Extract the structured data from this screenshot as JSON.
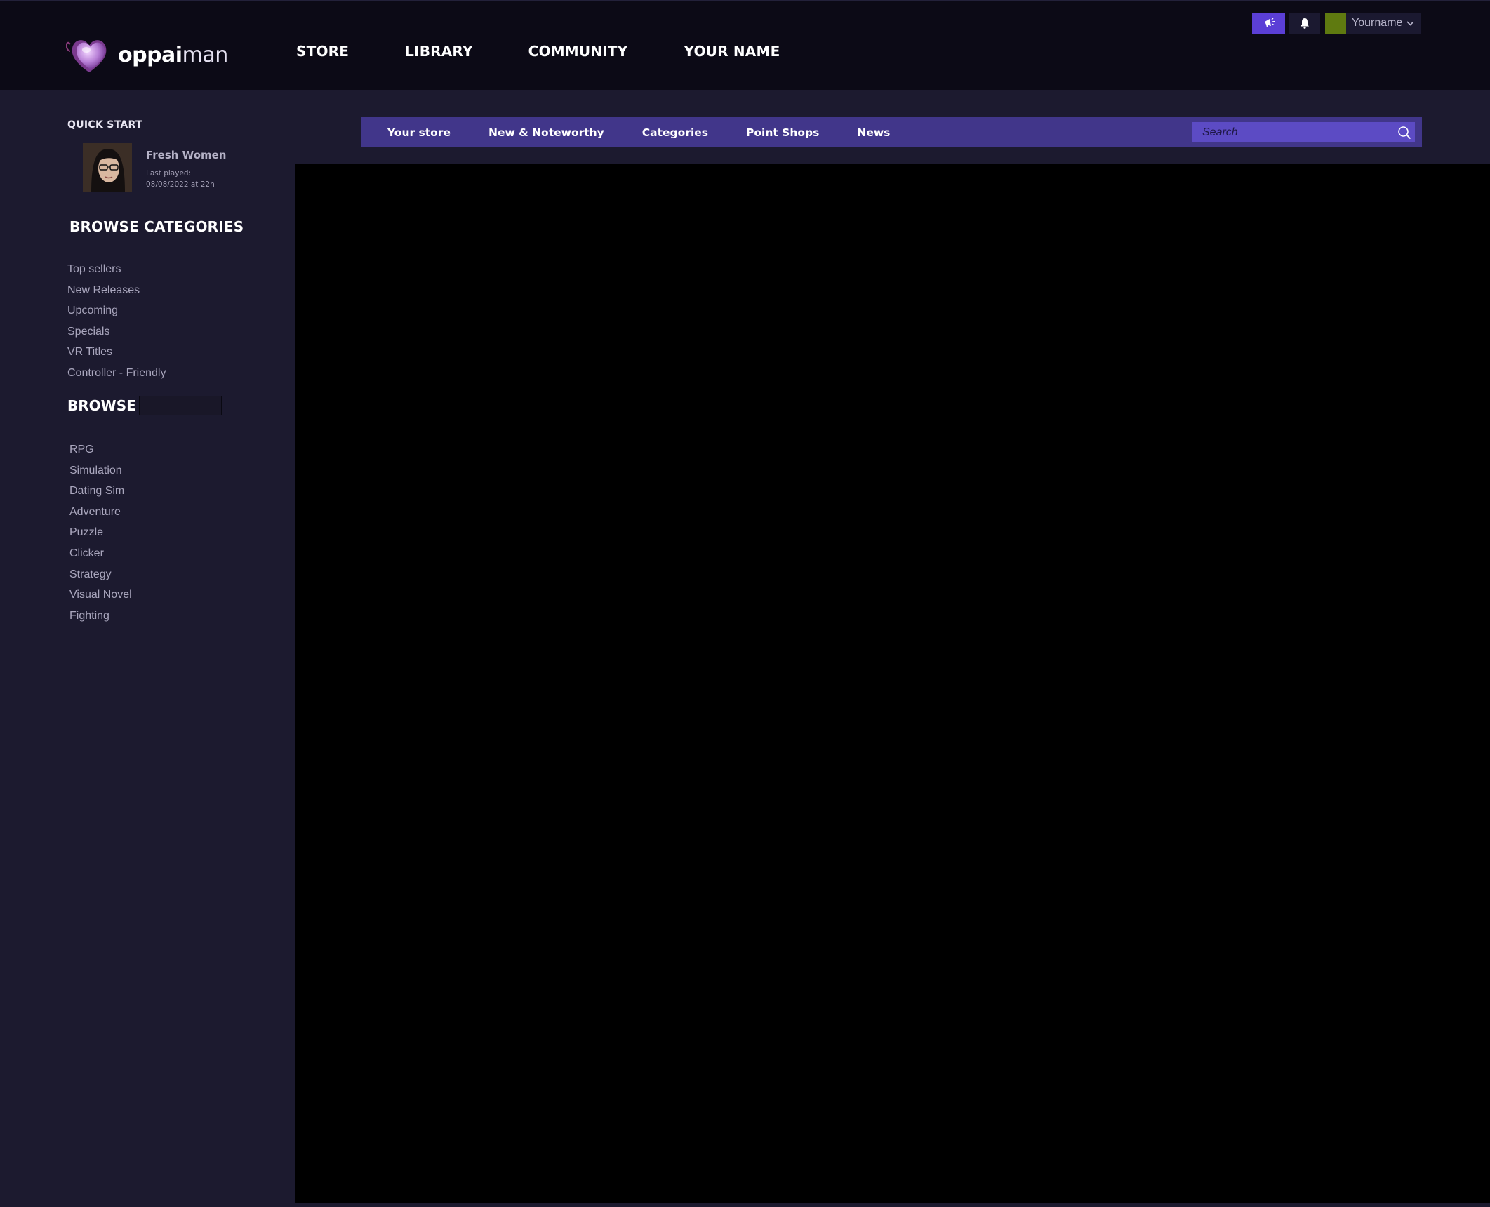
{
  "brand": {
    "logo_bold": "oppai",
    "logo_thin": "man"
  },
  "main_nav": [
    "STORE",
    "LIBRARY",
    "COMMUNITY",
    "YOUR NAME"
  ],
  "account": {
    "username": "Yourname",
    "install_icon": "megaphone-icon",
    "notifications_icon": "bell-icon",
    "avatar_color": "#5f7a10"
  },
  "quick_start": {
    "title": "QUICK START",
    "game_name": "Fresh Women",
    "last_played_label": "Last played:",
    "last_played_value": "08/08/2022 at 22h"
  },
  "browse_categories": {
    "title": "BROWSE CATEGORIES",
    "items": [
      "Top sellers",
      "New Releases",
      "Upcoming",
      "Specials",
      "VR Titles",
      "Controller - Friendly"
    ]
  },
  "browse": {
    "title": "BROWSE",
    "input_value": "",
    "genres": [
      "RPG",
      "Simulation",
      "Dating Sim",
      "Adventure",
      "Puzzle",
      "Clicker",
      "Strategy",
      "Visual Novel",
      "Fighting"
    ]
  },
  "store_nav": {
    "items": [
      "Your store",
      "New & Noteworthy",
      "Categories",
      "Point Shops",
      "News"
    ],
    "search_placeholder": "Search"
  },
  "colors": {
    "accent": "#5b3fd6",
    "store_nav_bg": "#41368a",
    "search_bg": "#5c4bc4",
    "sidebar_bg": "#1c1a2f",
    "header_bg": "#0c0a16"
  }
}
